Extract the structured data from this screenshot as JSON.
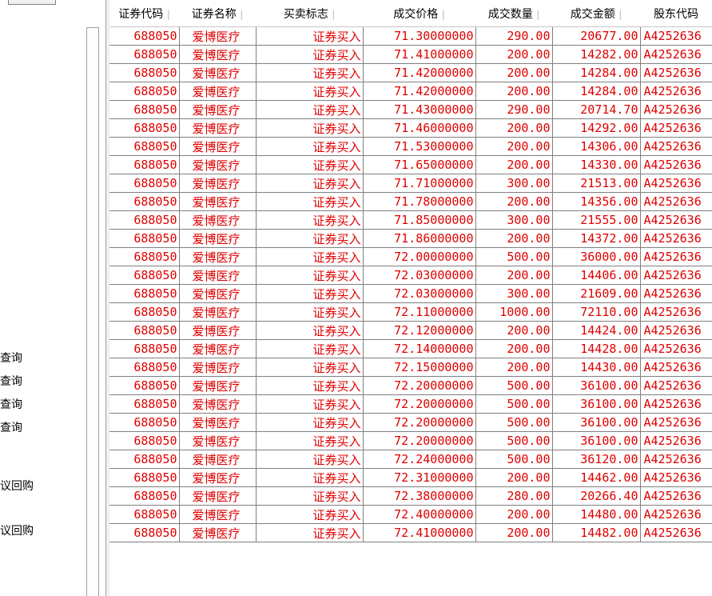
{
  "left_panel": {
    "items": [
      "查询",
      "查询",
      "查询",
      "查询",
      "议回购",
      "议回购"
    ]
  },
  "table": {
    "headers": [
      "证券代码",
      "证券名称",
      "买卖标志",
      "成交价格",
      "成交数量",
      "成交金额",
      "股东代码"
    ],
    "rows": [
      [
        "688050",
        "爱博医疗",
        "证券买入",
        "71.30000000",
        "290.00",
        "20677.00",
        "A4252636"
      ],
      [
        "688050",
        "爱博医疗",
        "证券买入",
        "71.41000000",
        "200.00",
        "14282.00",
        "A4252636"
      ],
      [
        "688050",
        "爱博医疗",
        "证券买入",
        "71.42000000",
        "200.00",
        "14284.00",
        "A4252636"
      ],
      [
        "688050",
        "爱博医疗",
        "证券买入",
        "71.42000000",
        "200.00",
        "14284.00",
        "A4252636"
      ],
      [
        "688050",
        "爱博医疗",
        "证券买入",
        "71.43000000",
        "290.00",
        "20714.70",
        "A4252636"
      ],
      [
        "688050",
        "爱博医疗",
        "证券买入",
        "71.46000000",
        "200.00",
        "14292.00",
        "A4252636"
      ],
      [
        "688050",
        "爱博医疗",
        "证券买入",
        "71.53000000",
        "200.00",
        "14306.00",
        "A4252636"
      ],
      [
        "688050",
        "爱博医疗",
        "证券买入",
        "71.65000000",
        "200.00",
        "14330.00",
        "A4252636"
      ],
      [
        "688050",
        "爱博医疗",
        "证券买入",
        "71.71000000",
        "300.00",
        "21513.00",
        "A4252636"
      ],
      [
        "688050",
        "爱博医疗",
        "证券买入",
        "71.78000000",
        "200.00",
        "14356.00",
        "A4252636"
      ],
      [
        "688050",
        "爱博医疗",
        "证券买入",
        "71.85000000",
        "300.00",
        "21555.00",
        "A4252636"
      ],
      [
        "688050",
        "爱博医疗",
        "证券买入",
        "71.86000000",
        "200.00",
        "14372.00",
        "A4252636"
      ],
      [
        "688050",
        "爱博医疗",
        "证券买入",
        "72.00000000",
        "500.00",
        "36000.00",
        "A4252636"
      ],
      [
        "688050",
        "爱博医疗",
        "证券买入",
        "72.03000000",
        "200.00",
        "14406.00",
        "A4252636"
      ],
      [
        "688050",
        "爱博医疗",
        "证券买入",
        "72.03000000",
        "300.00",
        "21609.00",
        "A4252636"
      ],
      [
        "688050",
        "爱博医疗",
        "证券买入",
        "72.11000000",
        "1000.00",
        "72110.00",
        "A4252636"
      ],
      [
        "688050",
        "爱博医疗",
        "证券买入",
        "72.12000000",
        "200.00",
        "14424.00",
        "A4252636"
      ],
      [
        "688050",
        "爱博医疗",
        "证券买入",
        "72.14000000",
        "200.00",
        "14428.00",
        "A4252636"
      ],
      [
        "688050",
        "爱博医疗",
        "证券买入",
        "72.15000000",
        "200.00",
        "14430.00",
        "A4252636"
      ],
      [
        "688050",
        "爱博医疗",
        "证券买入",
        "72.20000000",
        "500.00",
        "36100.00",
        "A4252636"
      ],
      [
        "688050",
        "爱博医疗",
        "证券买入",
        "72.20000000",
        "500.00",
        "36100.00",
        "A4252636"
      ],
      [
        "688050",
        "爱博医疗",
        "证券买入",
        "72.20000000",
        "500.00",
        "36100.00",
        "A4252636"
      ],
      [
        "688050",
        "爱博医疗",
        "证券买入",
        "72.20000000",
        "500.00",
        "36100.00",
        "A4252636"
      ],
      [
        "688050",
        "爱博医疗",
        "证券买入",
        "72.24000000",
        "500.00",
        "36120.00",
        "A4252636"
      ],
      [
        "688050",
        "爱博医疗",
        "证券买入",
        "72.31000000",
        "200.00",
        "14462.00",
        "A4252636"
      ],
      [
        "688050",
        "爱博医疗",
        "证券买入",
        "72.38000000",
        "280.00",
        "20266.40",
        "A4252636"
      ],
      [
        "688050",
        "爱博医疗",
        "证券买入",
        "72.40000000",
        "200.00",
        "14480.00",
        "A4252636"
      ],
      [
        "688050",
        "爱博医疗",
        "证券买入",
        "72.41000000",
        "200.00",
        "14482.00",
        "A4252636"
      ]
    ]
  },
  "colors": {
    "row_text": "#e00000",
    "header_text": "#000000",
    "grid_line": "#808080"
  }
}
